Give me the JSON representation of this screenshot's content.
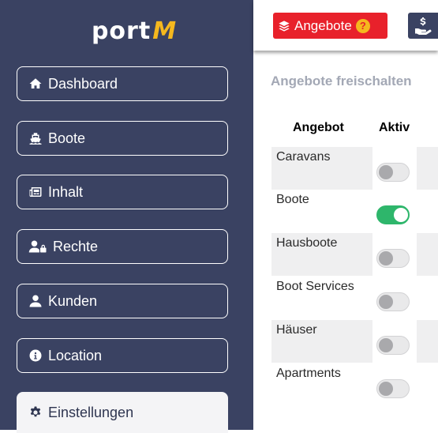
{
  "app": {
    "logo_part1": "port",
    "logo_part2": "M"
  },
  "sidebar": {
    "items": [
      {
        "label": "Dashboard",
        "icon": "home-icon"
      },
      {
        "label": "Boote",
        "icon": "ship-icon"
      },
      {
        "label": "Inhalt",
        "icon": "newspaper-icon"
      },
      {
        "label": "Rechte",
        "icon": "user-lock-icon"
      },
      {
        "label": "Kunden",
        "icon": "user-icon"
      },
      {
        "label": "Location",
        "icon": "info-circle-icon"
      },
      {
        "label": "Einstellungen",
        "icon": "gear-icon",
        "active": true
      }
    ]
  },
  "topbar": {
    "angebote_label": "Angebote",
    "help_glyph": "?",
    "dollar_icon": "hand-holding-dollar-icon"
  },
  "main": {
    "title": "Angebote freischalten",
    "columns": {
      "angebot": "Angebot",
      "aktiv": "Aktiv"
    },
    "rows": [
      {
        "label": "Caravans",
        "active": false
      },
      {
        "label": "Boote",
        "active": true
      },
      {
        "label": "Hausboote",
        "active": false
      },
      {
        "label": "Boot Services",
        "active": false
      },
      {
        "label": "Häuser",
        "active": false
      },
      {
        "label": "Apartments",
        "active": false
      }
    ]
  },
  "colors": {
    "sidebar_bg": "#3a4262",
    "accent_red": "#e8212b",
    "logo_yellow": "#f5b81e",
    "toggle_on": "#2eb66b"
  }
}
